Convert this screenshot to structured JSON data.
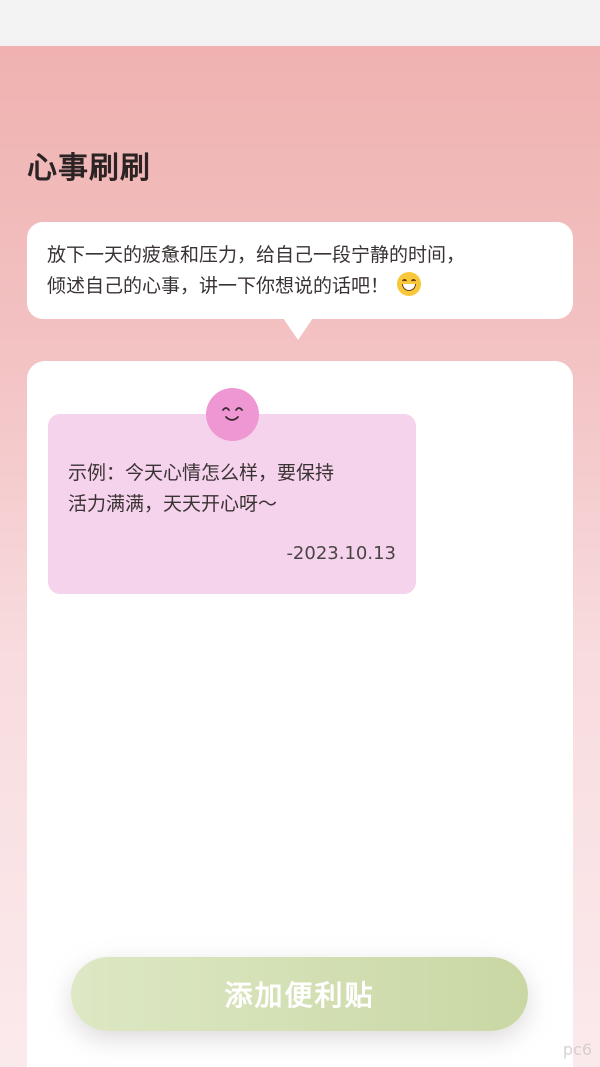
{
  "header": {
    "title": "心事刷刷"
  },
  "intro": {
    "line1": "放下一天的疲惫和压力，给自己一段宁静的时间，",
    "line2": "倾述自己的心事，讲一下你想说的话吧！",
    "emoji_icon": "grinning-face-icon"
  },
  "note": {
    "line1": "示例：今天心情怎么样，要保持",
    "line2": "活力满满，天天开心呀～",
    "date": "-2023.10.13",
    "avatar_icon": "smiling-face-icon",
    "color": "#f6d3ec"
  },
  "actions": {
    "add_label": "添加便利贴"
  },
  "watermark": "pc6",
  "colors": {
    "background_top": "#efb2b0",
    "button": "#c9d7a4",
    "avatar": "#ee97d2"
  }
}
